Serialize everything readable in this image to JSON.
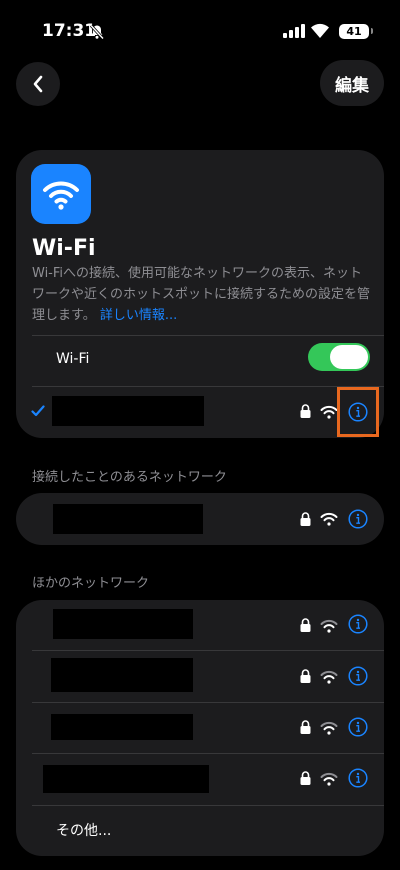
{
  "status_bar": {
    "time": "17:31",
    "battery": "41"
  },
  "nav": {
    "edit_label": "編集"
  },
  "wifi_card": {
    "title": "Wi-Fi",
    "description": "Wi-Fiへの接続、使用可能なネットワークの表示、ネットワークや近くのホットスポットに接続するための設定を管理します。",
    "learn_more": "詳しい情報...",
    "toggle_label": "Wi-Fi",
    "toggle_on": true
  },
  "known_networks": {
    "header": "接続したことのあるネットワーク"
  },
  "other_networks": {
    "header": "ほかのネットワーク",
    "other_label": "その他..."
  },
  "colors": {
    "accent": "#1a84ff",
    "toggle_on": "#34c759",
    "highlight": "#e8681f",
    "card": "#1c1c1e"
  },
  "icons": [
    "bell-slash-icon",
    "signal-icon",
    "wifi-icon",
    "battery-icon",
    "chevron-left-icon",
    "checkmark-icon",
    "lock-icon",
    "info-icon"
  ]
}
